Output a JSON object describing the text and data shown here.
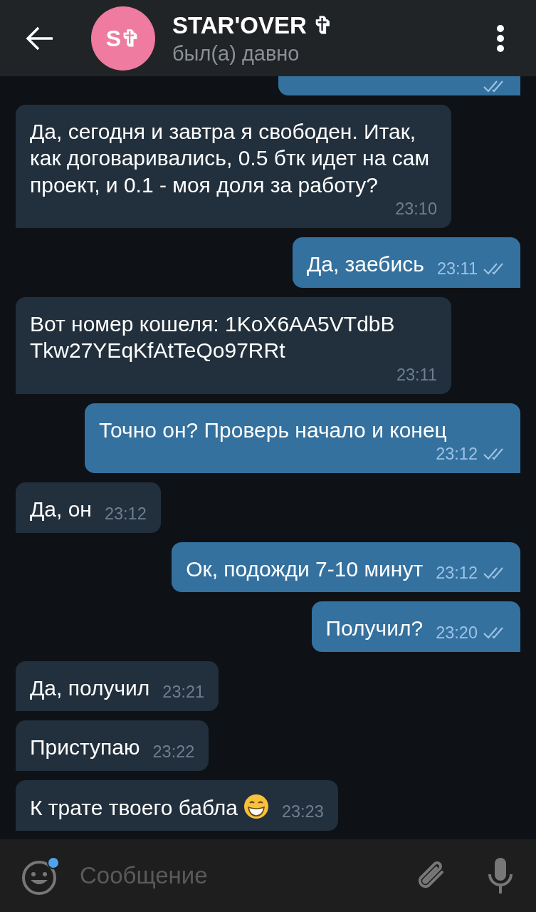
{
  "header": {
    "avatar_text": "S✞",
    "title": "STAR'OVER ✞",
    "status": "был(а) давно"
  },
  "messages": [
    {
      "kind": "out",
      "cut": true,
      "read": true
    },
    {
      "kind": "in",
      "text": "Да, сегодня и завтра я свободен. Итак, как договаривались, 0.5 бтк идет на сам проект, и 0.1 - моя доля за работу?",
      "time": "23:10"
    },
    {
      "kind": "out",
      "text": "Да, заебись",
      "time": "23:11",
      "read": true
    },
    {
      "kind": "in",
      "text": "Вот номер кошеля: 1KoX6AA5VTdbB Tkw27YEqKfAtTeQo97RRt",
      "time": "23:11"
    },
    {
      "kind": "out",
      "text": "Точно он? Проверь начало и конец",
      "time": "23:12",
      "read": true
    },
    {
      "kind": "in",
      "text": "Да, он",
      "time": "23:12"
    },
    {
      "kind": "out",
      "text": "Ок, подожди 7-10 минут",
      "time": "23:12",
      "read": true
    },
    {
      "kind": "out",
      "text": "Получил?",
      "time": "23:20",
      "read": true
    },
    {
      "kind": "in",
      "text": "Да, получил",
      "time": "23:21"
    },
    {
      "kind": "in",
      "text": "Приступаю",
      "time": "23:22"
    },
    {
      "kind": "in",
      "text": "К трате твоего бабла",
      "emoji": true,
      "time": "23:23"
    }
  ],
  "composer": {
    "placeholder": "Сообщение"
  }
}
